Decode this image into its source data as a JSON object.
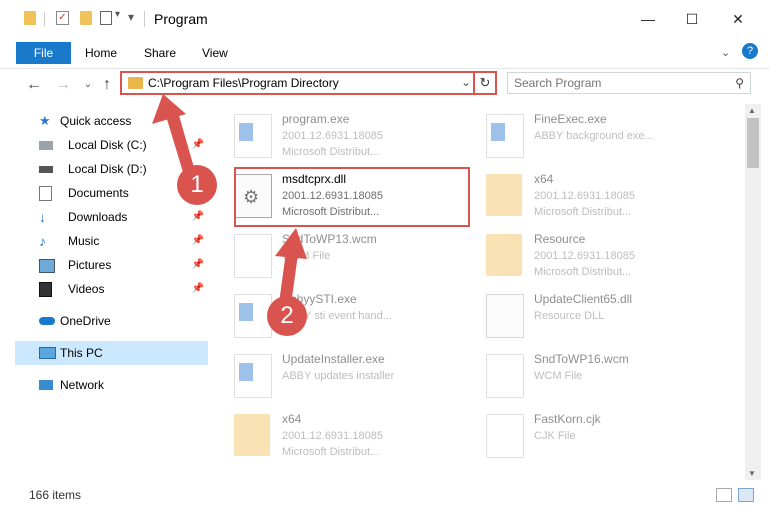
{
  "window": {
    "title": "Program",
    "minimize": "—",
    "maximize": "☐",
    "close": "✕"
  },
  "ribbon": {
    "tabs": [
      "File",
      "Home",
      "Share",
      "View"
    ],
    "help": "?"
  },
  "address": {
    "path": "C:\\Program Files\\Program Directory",
    "search_placeholder": "Search Program"
  },
  "nav": {
    "items": [
      {
        "label": "Quick access",
        "icon": "star-icon"
      },
      {
        "label": "Local Disk (C:)",
        "icon": "drive-icon",
        "pinned": true
      },
      {
        "label": "Local Disk (D:)",
        "icon": "drive-icon"
      },
      {
        "label": "Documents",
        "icon": "documents-icon",
        "pinned": true
      },
      {
        "label": "Downloads",
        "icon": "download-icon",
        "pinned": true
      },
      {
        "label": "Music",
        "icon": "music-icon",
        "pinned": true
      },
      {
        "label": "Pictures",
        "icon": "pictures-icon",
        "pinned": true
      },
      {
        "label": "Videos",
        "icon": "videos-icon",
        "pinned": true
      },
      {
        "label": "OneDrive",
        "icon": "cloud-icon"
      },
      {
        "label": "This PC",
        "icon": "computer-icon",
        "selected": true
      },
      {
        "label": "Network",
        "icon": "network-icon"
      }
    ]
  },
  "files": [
    {
      "name": "program.exe",
      "line1": "2001.12.6931.18085",
      "line2": "Microsoft Distribut...",
      "type": "exe",
      "highlighted": false
    },
    {
      "name": "FineExec.exe",
      "line1": "ABBY background exe...",
      "line2": "",
      "type": "exe",
      "highlighted": false
    },
    {
      "name": "msdtcprx.dll",
      "line1": "2001.12.6931.18085",
      "line2": "Microsoft Distribut...",
      "type": "dll",
      "highlighted": true
    },
    {
      "name": "x64",
      "line1": "2001.12.6931.18085",
      "line2": "Microsoft Distribut...",
      "type": "folder",
      "highlighted": false
    },
    {
      "name": "SndToWP13.wcm",
      "line1": "WCM File",
      "line2": "",
      "type": "doc",
      "highlighted": false
    },
    {
      "name": "Resource",
      "line1": "2001.12.6931.18085",
      "line2": "Microsoft Distribut...",
      "type": "folder",
      "highlighted": false
    },
    {
      "name": "AbbyySTI.exe",
      "line1": "ABBY sti event hand...",
      "line2": "",
      "type": "exe",
      "highlighted": false
    },
    {
      "name": "UpdateClient65.dll",
      "line1": "Resource DLL",
      "line2": "",
      "type": "dll",
      "highlighted": false
    },
    {
      "name": "UpdateInstaller.exe",
      "line1": "ABBY updates installer",
      "line2": "",
      "type": "exe",
      "highlighted": false
    },
    {
      "name": "SndToWP16.wcm",
      "line1": "WCM File",
      "line2": "",
      "type": "doc",
      "highlighted": false
    },
    {
      "name": "x64",
      "line1": "2001.12.6931.18085",
      "line2": "Microsoft Distribut...",
      "type": "folder",
      "highlighted": false
    },
    {
      "name": "FastKorn.cjk",
      "line1": "CJK File",
      "line2": "",
      "type": "doc",
      "highlighted": false
    }
  ],
  "status": {
    "item_count": "166 items"
  },
  "annotations": {
    "step1": "1",
    "step2": "2",
    "color": "#d9534f"
  }
}
